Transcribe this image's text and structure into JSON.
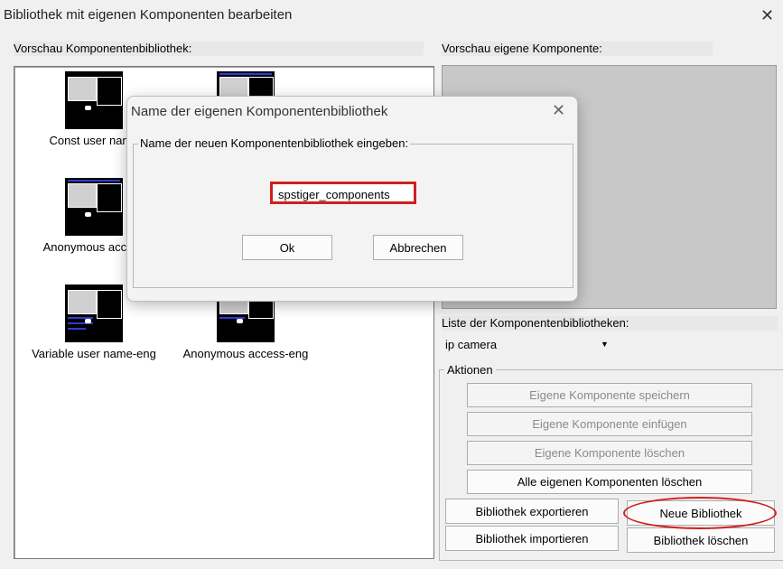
{
  "window": {
    "title": "Bibliothek mit eigenen Komponenten bearbeiten"
  },
  "left": {
    "label": "Vorschau Komponentenbibliothek:",
    "items": [
      {
        "label": "Const user name"
      },
      {
        "label": ""
      },
      {
        "label": "Anonymous access"
      },
      {
        "label": ""
      },
      {
        "label": "Variable user name-eng"
      },
      {
        "label": "Anonymous access-eng"
      }
    ]
  },
  "right": {
    "preview_label": "Vorschau eigene Komponente:",
    "libs_label": "Liste der Komponentenbibliotheken:",
    "combo_value": "ip camera",
    "actions_title": "Aktionen",
    "buttons": {
      "save": "Eigene Komponente speichern",
      "insert": "Eigene Komponente einfügen",
      "delete": "Eigene Komponente löschen",
      "delete_all": "Alle eigenen Komponenten löschen",
      "export": "Bibliothek exportieren",
      "new_lib": "Neue Bibliothek",
      "import": "Bibliothek importieren",
      "delete_lib": "Bibliothek löschen"
    }
  },
  "dialog": {
    "title": "Name der eigenen Komponentenbibliothek",
    "group_label": "Name der neuen Komponentenbibliothek eingeben:",
    "input_value": "spstiger_components",
    "ok": "Ok",
    "cancel": "Abbrechen"
  },
  "colors": {
    "highlight": "#d11f1f",
    "preview_bg": "#c8c8c8"
  }
}
